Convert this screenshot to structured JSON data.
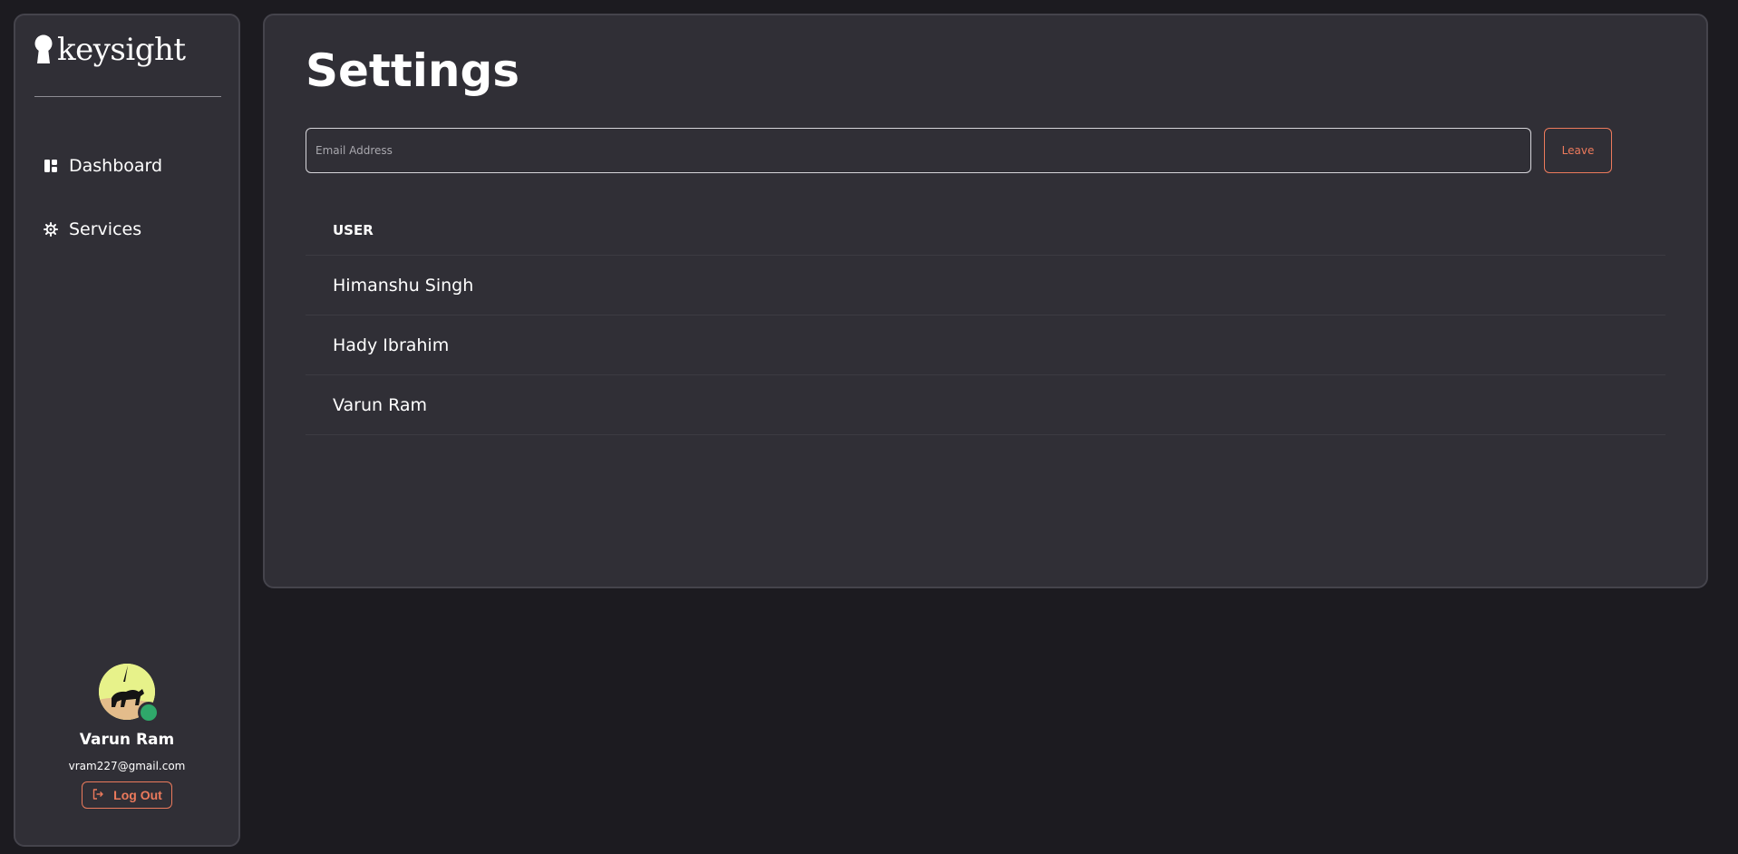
{
  "sidebar": {
    "logo_text": "keysight",
    "nav": [
      {
        "label": "Dashboard",
        "icon": "dashboard-icon"
      },
      {
        "label": "Services",
        "icon": "gear-icon"
      }
    ],
    "profile": {
      "name": "Varun Ram",
      "email": "vram227@gmail.com",
      "logout_label": "Log Out",
      "status": "online"
    }
  },
  "main": {
    "title": "Settings",
    "email_input": {
      "placeholder": "Email Address",
      "value": ""
    },
    "leave_label": "Leave",
    "table": {
      "header": "USER",
      "rows": [
        "Himanshu Singh",
        "Hady Ibrahim",
        "Varun Ram"
      ]
    }
  },
  "colors": {
    "background": "#1c1b20",
    "panel": "#302f36",
    "accent": "#ec7a5c",
    "status_online": "#2fa86a"
  }
}
